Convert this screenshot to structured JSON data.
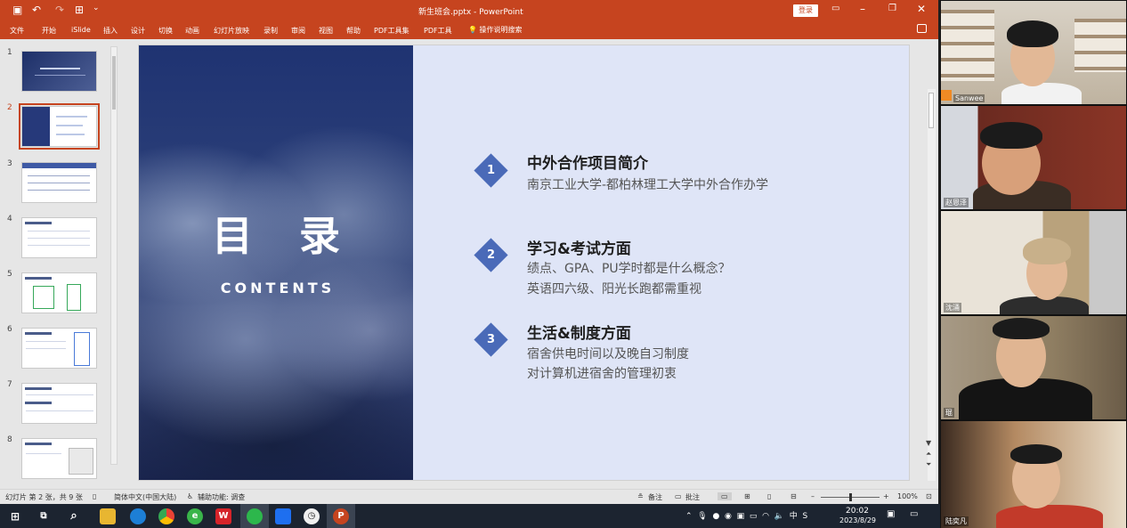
{
  "window": {
    "doc_title": "新生班会.pptx - PowerPoint",
    "login_label": "登录"
  },
  "ribbon": {
    "tabs": [
      "文件",
      "开始",
      "iSlide",
      "插入",
      "设计",
      "切换",
      "动画",
      "幻灯片放映",
      "录制",
      "审阅",
      "视图",
      "帮助",
      "PDF工具集",
      "PDF工具"
    ],
    "search_label": "操作说明搜索"
  },
  "thumbnails": {
    "numbers": [
      "1",
      "2",
      "3",
      "4",
      "5",
      "6",
      "7",
      "8"
    ],
    "active_index": 2
  },
  "slide": {
    "title": "目 录",
    "subtitle": "CONTENTS",
    "items": [
      {
        "number": "1",
        "title": "中外合作项目简介",
        "lines": [
          "南京工业大学-都柏林理工大学中外合作办学"
        ]
      },
      {
        "number": "2",
        "title": "学习&考试方面",
        "lines": [
          "绩点、GPA、PU学时都是什么概念？",
          "英语四六级、阳光长跑都需重视"
        ]
      },
      {
        "number": "3",
        "title": "生活&制度方面",
        "lines": [
          "宿舍供电时间以及晚自习制度",
          "对计算机进宿舍的管理初衷"
        ]
      }
    ]
  },
  "status": {
    "slide_info": "幻灯片 第 2 张，共 9 张",
    "language": "简体中文(中国大陆)",
    "accessibility": "辅助功能: 调查",
    "notes": "备注",
    "comments": "批注",
    "zoom": "100%"
  },
  "taskbar": {
    "tray_lang": "中",
    "time": "20:02",
    "date": "2023/8/29"
  },
  "participants": [
    "Sanwee",
    "赵恩泽",
    "沈涌",
    "琨",
    "陆奕凡"
  ],
  "colors": {
    "accent": "#c6441f",
    "slide_bg": "#dfe5f7",
    "diamond": "#4a6ab8"
  }
}
